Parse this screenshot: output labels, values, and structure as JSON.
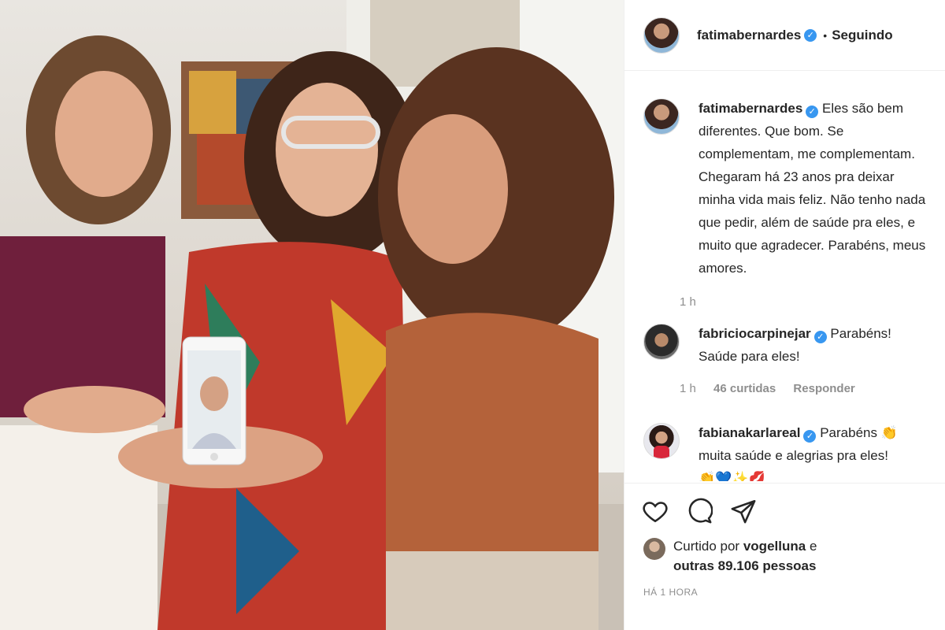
{
  "post": {
    "author": "fatimabernardes",
    "follow_state": "Seguindo",
    "caption": "Eles são bem diferentes. Que bom. Se complementam, me complementam. Chegaram há 23 anos pra deixar minha vida mais feliz. Não tenho nada que pedir, além de saúde pra eles, e muito que agradecer. Parabéns, meus amores.",
    "caption_lines": [
      "Eles são bem",
      "diferentes. Que bom. Se",
      "complementam, me complementam.",
      "Chegaram há 23 anos pra deixar",
      "minha vida mais feliz. Não tenho nada",
      "que pedir, além de saúde pra eles, e",
      "muito que agradecer. Parabéns, meus",
      "amores."
    ],
    "caption_time": "1 h",
    "posted_ago": "HÁ 1 HORA"
  },
  "comments": [
    {
      "user": "fabriciocarpinejar",
      "text_line1": "Parabéns!",
      "text_line2": "Saúde para eles!",
      "time": "1 h",
      "likes": "46 curtidas",
      "reply": "Responder"
    },
    {
      "user": "fabianakarlareal",
      "text_line1": "Parabéns 👏",
      "text_line2": "muita saúde e alegrias pra eles!",
      "text_line3": "👏💙✨💋"
    }
  ],
  "likes": {
    "prefix": "Curtido por",
    "first_user": "vogelluna",
    "conjunction": "e",
    "others": "outras 89.106 pessoas"
  },
  "icons": [
    "heart-icon",
    "comment-icon",
    "share-icon",
    "verified-badge-icon"
  ],
  "colors": {
    "verified": "#3897f0",
    "text": "#262626",
    "muted": "#8e8e8e",
    "border": "#efefef"
  }
}
